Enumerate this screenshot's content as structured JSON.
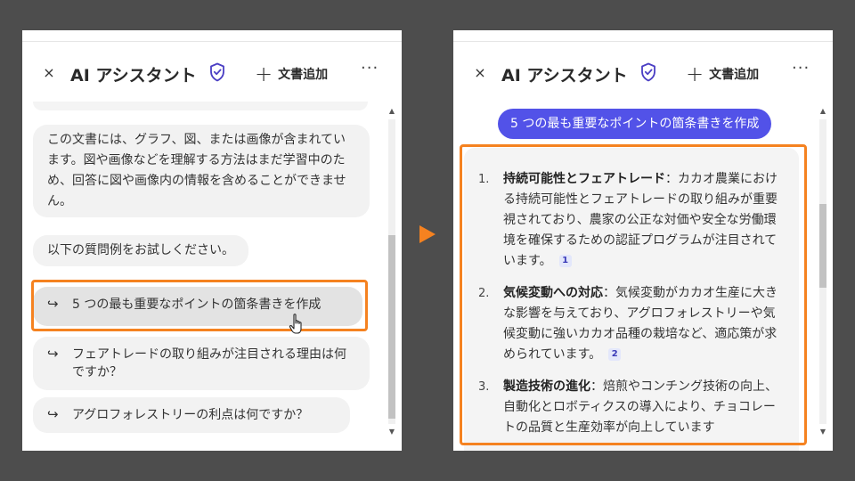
{
  "header": {
    "title": "AI アシスタント",
    "add_doc_label": "文書追加",
    "close_glyph": "×",
    "more_glyph": "···"
  },
  "left_panel": {
    "info_message": "この文書には、グラフ、図、または画像が含まれています。図や画像などを理解する方法はまだ学習中のため、回答に図や画像内の情報を含めることができません。",
    "prompt_message": "以下の質問例をお試しください。",
    "suggestions": [
      "5 つの最も重要なポイントの箇条書きを作成",
      "フェアトレードの取り組みが注目される理由は何ですか？",
      "アグロフォレストリーの利点は何ですか？"
    ]
  },
  "right_panel": {
    "user_query": "5 つの最も重要なポイントの箇条書きを作成",
    "answer_items": [
      {
        "num": "1.",
        "title": "持続可能性とフェアトレード",
        "body": "：カカオ農業における持続可能性とフェアトレードの取り組みが重要視されており、農家の公正な対価や安全な労働環境を確保するための認証プログラムが注目されています。",
        "cite": "1"
      },
      {
        "num": "2.",
        "title": "気候変動への対応",
        "body": "：気候変動がカカオ生産に大きな影響を与えており、アグロフォレストリーや気候変動に強いカカオ品種の栽培など、適応策が求められています。",
        "cite": "2"
      },
      {
        "num": "3.",
        "title": "製造技術の進化",
        "body": "：焙煎やコンチング技術の向上、自動化とロボティクスの導入により、チョコレートの品質と生産効率が向上しています",
        "cite": ""
      }
    ]
  },
  "colors": {
    "highlight": "#f58220",
    "query_bubble": "#5252e8",
    "background": "#4d4d4d"
  },
  "icons": {
    "close": "close-icon",
    "shield": "shield-check-icon",
    "add": "plus-icon",
    "more": "more-icon",
    "suggestion": "arrow-return-icon",
    "cursor": "hand-pointer-icon",
    "transition": "play-arrow-icon"
  }
}
